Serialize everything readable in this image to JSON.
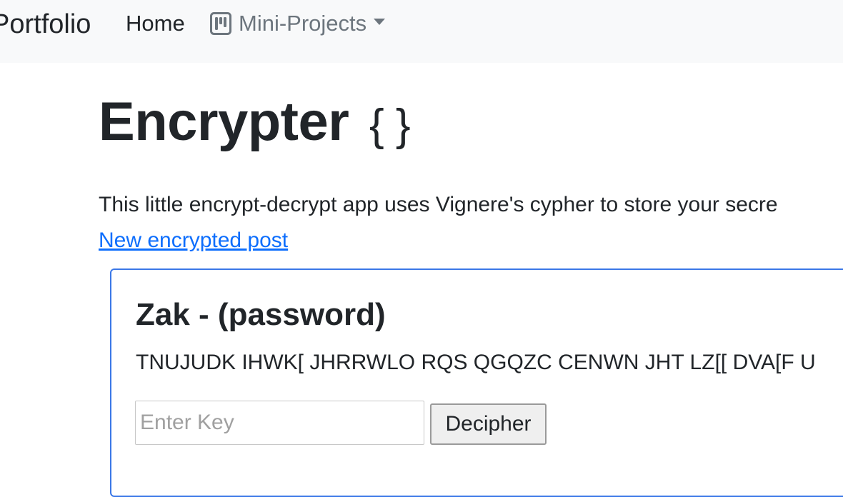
{
  "navbar": {
    "brand": "Portfolio",
    "home_label": "Home",
    "dropdown_label": "Mini-Projects"
  },
  "main": {
    "title": "Encrypter",
    "title_icon": "{ }",
    "intro": "This little encrypt-decrypt app uses Vignere's cypher to store your secre",
    "new_post_link": "New encrypted post"
  },
  "post": {
    "title": "Zak - (password)",
    "cipher_text": "TNUJUDK IHWK[ JHRRWLO RQS QGQZC CENWN JHT LZ[[ DVA[F U",
    "key_value": "",
    "key_placeholder": "Enter Key",
    "decipher_label": "Decipher"
  },
  "colors": {
    "navbar_bg": "#f8f9fa",
    "link": "#0d6efd",
    "card_border": "#3b78e7",
    "muted": "#6c757d"
  }
}
